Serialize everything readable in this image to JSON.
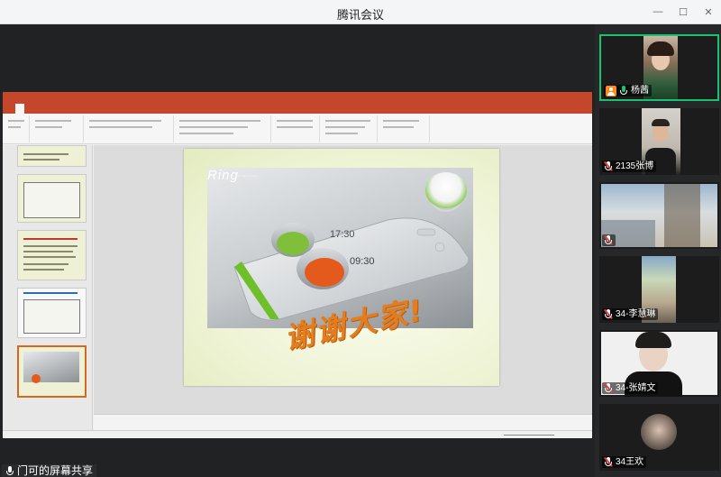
{
  "app": {
    "title": "腾讯会议"
  },
  "share": {
    "label": "门可的屏幕共享"
  },
  "participants": [
    {
      "name": "杨茜",
      "mic": "on",
      "host": true,
      "active": true
    },
    {
      "name": "2135张博",
      "mic": "muted"
    },
    {
      "name": "",
      "mic": "muted"
    },
    {
      "name": "34-李慧琳",
      "mic": "muted"
    },
    {
      "name": "34-张婧文",
      "mic": "muted"
    },
    {
      "name": "34王欢",
      "mic": "muted"
    }
  ],
  "ppt": {
    "slide": {
      "brand": "Ring",
      "brand_sub": "weighsought",
      "time_top": "17:30",
      "time_bottom": "09:30",
      "thanks": "谢谢大家!"
    }
  },
  "colors": {
    "accent_ppt": "#c5462b",
    "active_speaker": "#18c26f",
    "thanks_text": "#e37d1e"
  }
}
